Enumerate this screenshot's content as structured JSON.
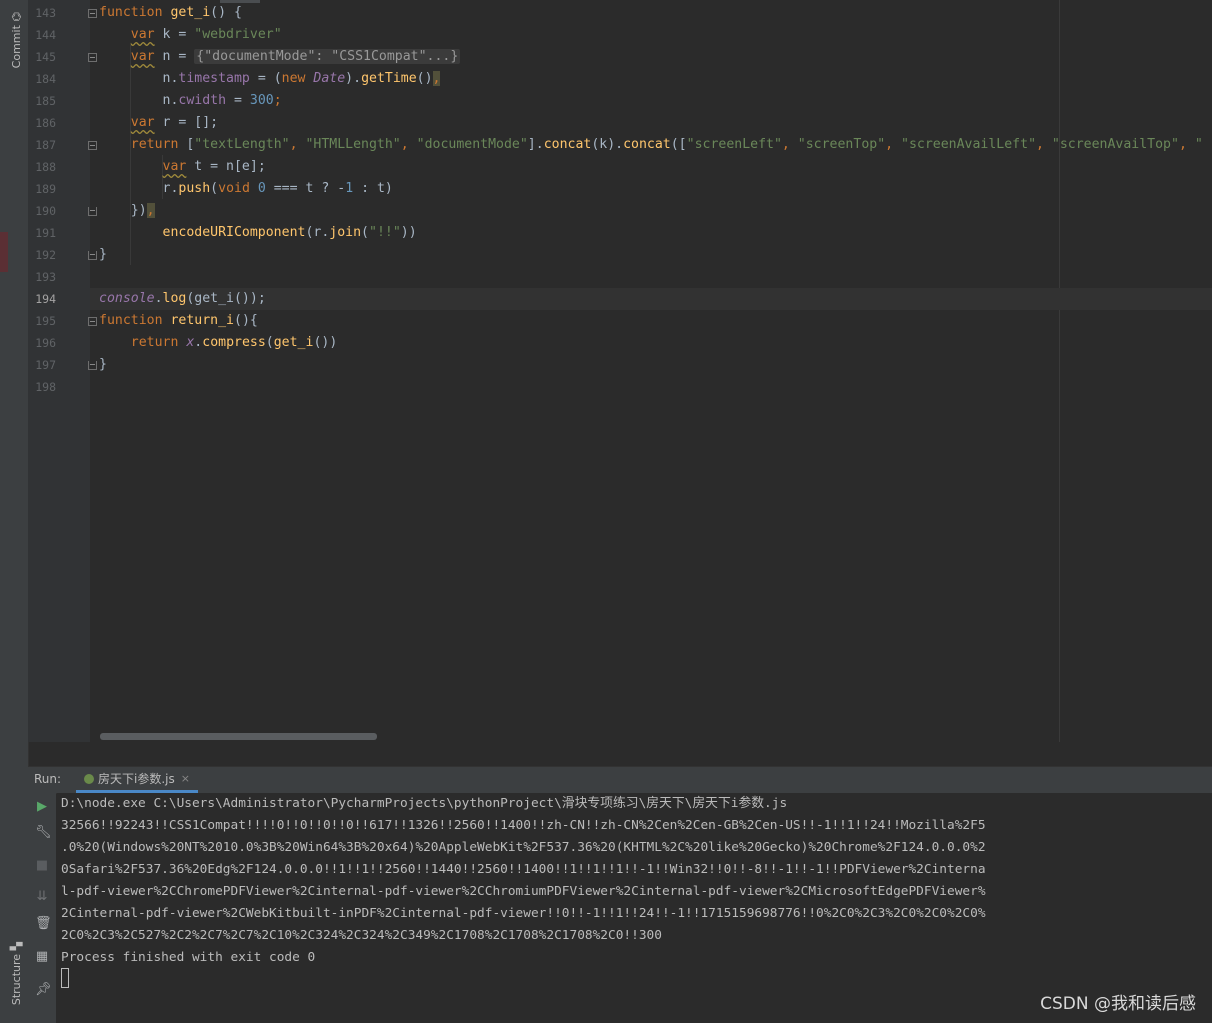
{
  "side_tabs": {
    "commit": "Commit",
    "structure": "Structure"
  },
  "editor": {
    "current_line": "194",
    "lines": [
      {
        "num": "143",
        "tokens": [
          {
            "t": "function ",
            "c": "kw"
          },
          {
            "t": "get_i",
            "c": "fn"
          },
          {
            "t": "() {",
            "c": "plain"
          }
        ]
      },
      {
        "num": "144",
        "tokens": [
          {
            "t": "    ",
            "c": "plain"
          },
          {
            "t": "var",
            "c": "kw squig"
          },
          {
            "t": " k = ",
            "c": "plain"
          },
          {
            "t": "\"webdriver\"",
            "c": "str"
          }
        ]
      },
      {
        "num": "145",
        "tokens": [
          {
            "t": "    ",
            "c": "plain"
          },
          {
            "t": "var",
            "c": "kw squig"
          },
          {
            "t": " n = ",
            "c": "plain"
          },
          {
            "t": "{\"documentMode\": \"CSS1Compat\"...}",
            "c": "inlay"
          }
        ]
      },
      {
        "num": "184",
        "tokens": [
          {
            "t": "        n.",
            "c": "plain"
          },
          {
            "t": "timestamp",
            "c": "prop"
          },
          {
            "t": " = (",
            "c": "plain"
          },
          {
            "t": "new ",
            "c": "kw"
          },
          {
            "t": "Date",
            "c": "glob"
          },
          {
            "t": ").",
            "c": "plain"
          },
          {
            "t": "getTime",
            "c": "fn"
          },
          {
            "t": "()",
            "c": "plain"
          },
          {
            "t": ",",
            "c": "kw hl"
          }
        ]
      },
      {
        "num": "185",
        "tokens": [
          {
            "t": "        n.",
            "c": "plain"
          },
          {
            "t": "cwidth",
            "c": "prop"
          },
          {
            "t": " = ",
            "c": "plain"
          },
          {
            "t": "300",
            "c": "num"
          },
          {
            "t": ";",
            "c": "kw"
          }
        ]
      },
      {
        "num": "186",
        "tokens": [
          {
            "t": "    ",
            "c": "plain"
          },
          {
            "t": "var",
            "c": "kw squig"
          },
          {
            "t": " r = [];",
            "c": "plain"
          }
        ]
      },
      {
        "num": "187",
        "tokens": [
          {
            "t": "    ",
            "c": "plain"
          },
          {
            "t": "return ",
            "c": "kw"
          },
          {
            "t": "[",
            "c": "plain"
          },
          {
            "t": "\"textLength\"",
            "c": "str"
          },
          {
            "t": ", ",
            "c": "kw"
          },
          {
            "t": "\"HTMLLength\"",
            "c": "str"
          },
          {
            "t": ", ",
            "c": "kw"
          },
          {
            "t": "\"documentMode\"",
            "c": "str"
          },
          {
            "t": "].",
            "c": "plain"
          },
          {
            "t": "concat",
            "c": "fn"
          },
          {
            "t": "(k).",
            "c": "plain"
          },
          {
            "t": "concat",
            "c": "fn"
          },
          {
            "t": "([",
            "c": "plain"
          },
          {
            "t": "\"screenLeft\"",
            "c": "str"
          },
          {
            "t": ", ",
            "c": "kw"
          },
          {
            "t": "\"screenTop\"",
            "c": "str"
          },
          {
            "t": ", ",
            "c": "kw"
          },
          {
            "t": "\"screenAvailLeft\"",
            "c": "str"
          },
          {
            "t": ", ",
            "c": "kw"
          },
          {
            "t": "\"screenAvailTop\"",
            "c": "str"
          },
          {
            "t": ", ",
            "c": "kw"
          },
          {
            "t": "\"",
            "c": "str"
          }
        ]
      },
      {
        "num": "188",
        "tokens": [
          {
            "t": "        ",
            "c": "plain"
          },
          {
            "t": "var",
            "c": "kw squig"
          },
          {
            "t": " t = n[e];",
            "c": "plain"
          }
        ]
      },
      {
        "num": "189",
        "tokens": [
          {
            "t": "        r.",
            "c": "plain"
          },
          {
            "t": "push",
            "c": "fn"
          },
          {
            "t": "(",
            "c": "plain"
          },
          {
            "t": "void ",
            "c": "kw"
          },
          {
            "t": "0",
            "c": "num"
          },
          {
            "t": " === t ? -",
            "c": "plain"
          },
          {
            "t": "1",
            "c": "num"
          },
          {
            "t": " : t)",
            "c": "plain"
          }
        ]
      },
      {
        "num": "190",
        "tokens": [
          {
            "t": "    })",
            "c": "plain"
          },
          {
            "t": ",",
            "c": "kw hl"
          }
        ]
      },
      {
        "num": "191",
        "tokens": [
          {
            "t": "        ",
            "c": "plain"
          },
          {
            "t": "encodeURIComponent",
            "c": "fn"
          },
          {
            "t": "(r.",
            "c": "plain"
          },
          {
            "t": "join",
            "c": "fn"
          },
          {
            "t": "(",
            "c": "plain"
          },
          {
            "t": "\"!!\"",
            "c": "str"
          },
          {
            "t": "))",
            "c": "plain"
          }
        ]
      },
      {
        "num": "192",
        "tokens": [
          {
            "t": "}",
            "c": "plain"
          }
        ]
      },
      {
        "num": "193",
        "tokens": []
      },
      {
        "num": "194",
        "tokens": [
          {
            "t": "console",
            "c": "glob"
          },
          {
            "t": ".",
            "c": "plain"
          },
          {
            "t": "log",
            "c": "fn"
          },
          {
            "t": "(get_i());",
            "c": "plain"
          }
        ]
      },
      {
        "num": "195",
        "tokens": [
          {
            "t": "function ",
            "c": "kw"
          },
          {
            "t": "return_i",
            "c": "fn"
          },
          {
            "t": "(){",
            "c": "plain"
          }
        ]
      },
      {
        "num": "196",
        "tokens": [
          {
            "t": "    ",
            "c": "plain"
          },
          {
            "t": "return ",
            "c": "kw"
          },
          {
            "t": "x",
            "c": "glob"
          },
          {
            "t": ".",
            "c": "plain"
          },
          {
            "t": "compress",
            "c": "fn"
          },
          {
            "t": "(",
            "c": "plain"
          },
          {
            "t": "get_i",
            "c": "fn"
          },
          {
            "t": "())",
            "c": "plain"
          }
        ]
      },
      {
        "num": "197",
        "tokens": [
          {
            "t": "}",
            "c": "plain"
          }
        ]
      },
      {
        "num": "198",
        "tokens": []
      }
    ]
  },
  "run": {
    "title": "Run:",
    "tab_label": "房天下i参数.js",
    "tab_close": "×",
    "console_lines": [
      "D:\\node.exe C:\\Users\\Administrator\\PycharmProjects\\pythonProject\\滑块专项练习\\房天下\\房天下i参数.js",
      "32566!!92243!!CSS1Compat!!!!0!!0!!0!!0!!617!!1326!!2560!!1400!!zh-CN!!zh-CN%2Cen%2Cen-GB%2Cen-US!!-1!!1!!24!!Mozilla%2F5",
      ".0%20(Windows%20NT%2010.0%3B%20Win64%3B%20x64)%20AppleWebKit%2F537.36%20(KHTML%2C%20like%20Gecko)%20Chrome%2F124.0.0.0%2",
      "0Safari%2F537.36%20Edg%2F124.0.0.0!!1!!1!!2560!!1440!!2560!!1400!!1!!1!!1!!-1!!Win32!!0!!-8!!-1!!-1!!PDFViewer%2Cinterna",
      "l-pdf-viewer%2CChromePDFViewer%2Cinternal-pdf-viewer%2CChromiumPDFViewer%2Cinternal-pdf-viewer%2CMicrosoftEdgePDFViewer%",
      "2Cinternal-pdf-viewer%2CWebKitbuilt-inPDF%2Cinternal-pdf-viewer!!0!!-1!!1!!24!!-1!!1715159698776!!0%2C0%2C3%2C0%2C0%2C0%",
      "2C0%2C3%2C527%2C2%2C7%2C7%2C10%2C324%2C324%2C349%2C1708%2C1708%2C1708%2C0!!300",
      "Process finished with exit code 0"
    ]
  },
  "watermark": "CSDN @我和读后感"
}
